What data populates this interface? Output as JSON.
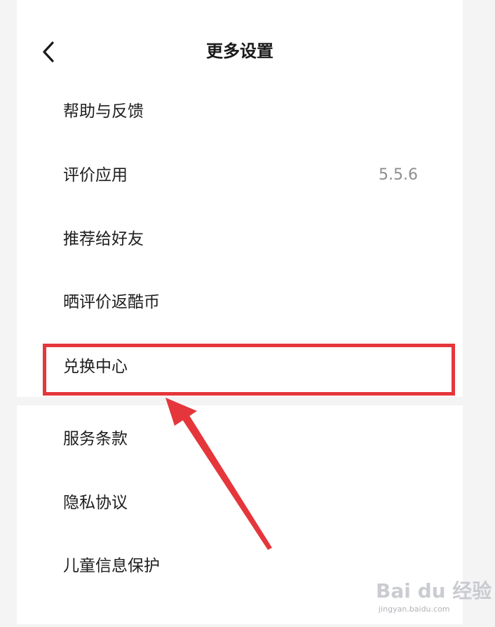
{
  "header": {
    "title": "更多设置",
    "back_icon": "chevron-left-icon"
  },
  "menu_items": [
    {
      "label": "帮助与反馈",
      "value": ""
    },
    {
      "label": "评价应用",
      "value": "5.5.6"
    },
    {
      "label": "推荐给好友",
      "value": ""
    },
    {
      "label": "晒评价返酷币",
      "value": ""
    },
    {
      "label": "兑换中心",
      "value": "",
      "highlighted": true
    },
    {
      "label": "服务条款",
      "value": ""
    },
    {
      "label": "隐私协议",
      "value": ""
    },
    {
      "label": "儿童信息保护",
      "value": ""
    }
  ],
  "annotation": {
    "highlight_color": "#e5363b",
    "arrow_color": "#e5363b"
  },
  "watermark": {
    "main": "Bai du 经验",
    "sub": "jingyan.baidu.com"
  }
}
